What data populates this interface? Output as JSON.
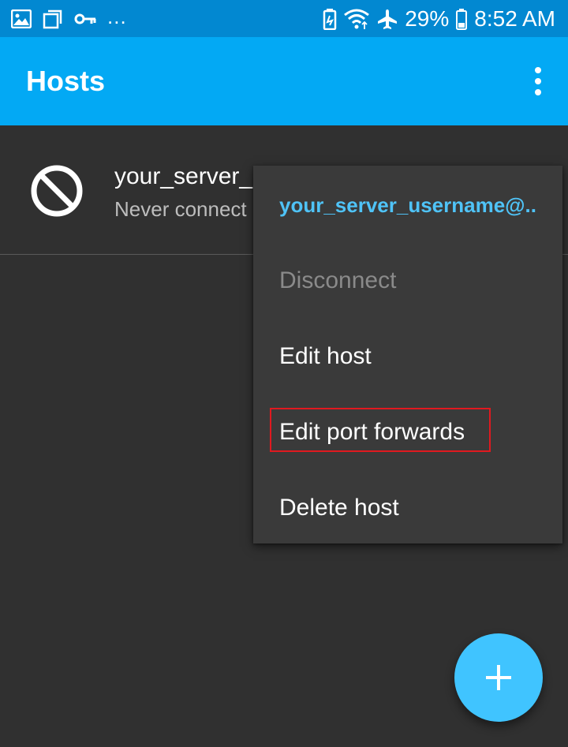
{
  "status_bar": {
    "left_icons": [
      "gallery-icon",
      "recent-apps-icon",
      "vpn-key-icon"
    ],
    "more_indicator": "...",
    "right_icons": [
      "battery-saver-icon",
      "wifi-icon",
      "airplane-mode-icon"
    ],
    "battery_percent": "29%",
    "time": "8:52 AM"
  },
  "app_bar": {
    "title": "Hosts",
    "menu_icon": "overflow-menu-icon"
  },
  "hosts": [
    {
      "icon": "disconnected-icon",
      "name": "your_server_",
      "status": "Never connect"
    }
  ],
  "context_menu": {
    "header": "your_server_username@..",
    "items": [
      {
        "label": "Disconnect",
        "enabled": false
      },
      {
        "label": "Edit host",
        "enabled": true
      },
      {
        "label": "Edit port forwards",
        "enabled": true,
        "highlighted": true
      },
      {
        "label": "Delete host",
        "enabled": true
      }
    ]
  },
  "fab": {
    "icon": "add-icon"
  },
  "colors": {
    "status_bar": "#0288d1",
    "app_bar": "#03a9f4",
    "background": "#303030",
    "menu_background": "#3a3a3a",
    "menu_header_text": "#4fc3f7",
    "highlight_border": "#e0191f",
    "fab": "#40c4ff"
  }
}
